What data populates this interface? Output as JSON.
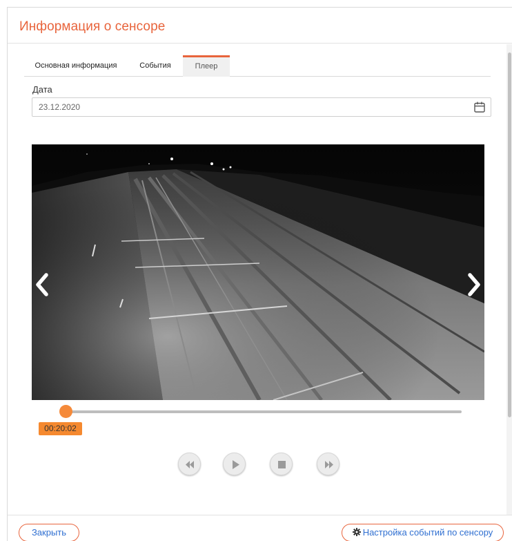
{
  "dialog": {
    "title": "Информация о сенсоре"
  },
  "tabs": [
    {
      "label": "Основная информация",
      "active": false
    },
    {
      "label": "События",
      "active": false
    },
    {
      "label": "Плеер",
      "active": true
    }
  ],
  "date": {
    "label": "Дата",
    "value": "23.12.2020",
    "icon": "calendar-icon"
  },
  "player": {
    "prev_icon": "chevron-left-icon",
    "next_icon": "chevron-right-icon",
    "progress_fraction": 0.01,
    "current_time": "00:20:02",
    "controls": [
      {
        "name": "rewind",
        "icon": "rewind-icon"
      },
      {
        "name": "play",
        "icon": "play-icon"
      },
      {
        "name": "stop",
        "icon": "stop-icon"
      },
      {
        "name": "fast-forward",
        "icon": "fast-forward-icon"
      }
    ]
  },
  "footer": {
    "close_label": "Закрыть",
    "settings_label": "Настройка событий по сенсору",
    "settings_icon": "gear-icon"
  },
  "colors": {
    "accent": "#e8643c",
    "link": "#2f6fd1",
    "badge": "#f5892f"
  }
}
